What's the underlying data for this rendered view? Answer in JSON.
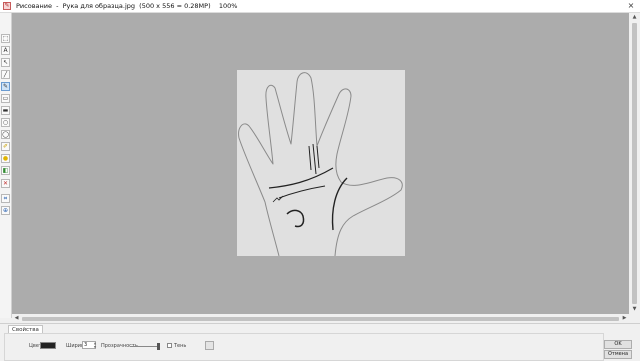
{
  "window": {
    "title": "Рисование  -  Рука для образца.jpg  (500 x 556 = 0.28MP)    100%",
    "close_glyph": "×"
  },
  "toolbox": {
    "tools": [
      {
        "name": "select-tool-icon",
        "glyph": "⬚"
      },
      {
        "name": "text-tool-icon",
        "glyph": "A"
      },
      {
        "name": "arrow-tool-icon",
        "glyph": "↖"
      },
      {
        "name": "line-tool-icon",
        "glyph": "╱"
      },
      {
        "name": "pencil-tool-icon",
        "glyph": "✎"
      },
      {
        "name": "rectangle-tool-icon",
        "glyph": "▭"
      },
      {
        "name": "filled-rectangle-tool-icon",
        "glyph": "▬"
      },
      {
        "name": "ellipse-tool-icon",
        "glyph": "○"
      },
      {
        "name": "circle-tool-icon",
        "glyph": "◯"
      },
      {
        "name": "marker-tool-icon",
        "glyph": "✐"
      },
      {
        "name": "highlighter-tool-icon",
        "glyph": "●"
      },
      {
        "name": "fill-tool-icon",
        "glyph": "◧"
      },
      {
        "name": "eraser-tool-icon",
        "glyph": "✕"
      },
      {
        "name": "crop-tool-icon",
        "glyph": "⌗"
      },
      {
        "name": "zoom-tool-icon",
        "glyph": "⊕"
      }
    ]
  },
  "panel": {
    "tab_label": "Свойства",
    "color_label": "Цвет",
    "width_label": "Ширина",
    "width_value": "3",
    "opacity_label": "Прозрачность",
    "shadow_label": "Тень",
    "ok_label": "OK",
    "cancel_label": "Отмена"
  },
  "colors": {
    "canvas_background": "#acacac",
    "image_background": "#e0e0e0",
    "stroke_color": "#222222",
    "outline_color": "#8a8a8a"
  }
}
